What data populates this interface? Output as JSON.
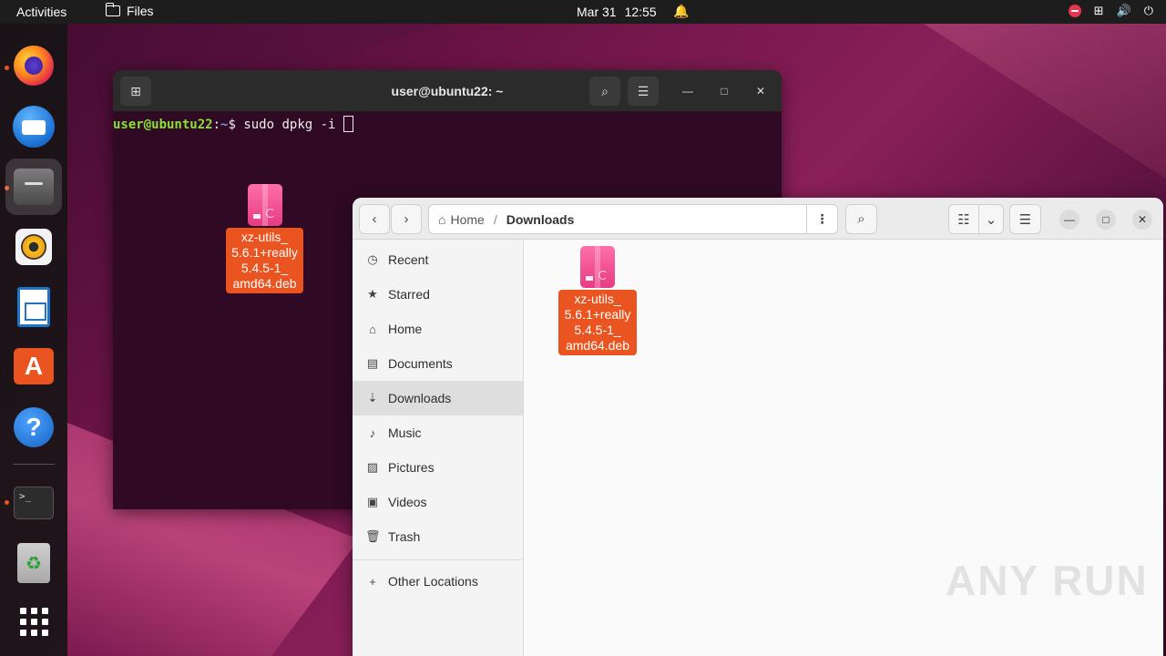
{
  "topbar": {
    "activities": "Activities",
    "app_name": "Files",
    "date": "Mar 31",
    "time": "12:55"
  },
  "dock": {
    "items": [
      "firefox-icon",
      "thunderbird-icon",
      "files-icon",
      "rhythmbox-icon",
      "libreoffice-writer-icon",
      "app-center-icon",
      "help-icon",
      "terminal-icon",
      "trash-icon",
      "show-apps-icon"
    ]
  },
  "terminal": {
    "title": "user@ubuntu22: ~",
    "prompt_user": "user@ubuntu22",
    "prompt_sep": ":",
    "prompt_dir": "~",
    "prompt_sym": "$ ",
    "command": "sudo dpkg -i "
  },
  "desktop_file": {
    "name": "xz-utils_ 5.6.1+really 5.4.5-1_ amd64.deb",
    "line1": "xz-utils_",
    "line2": "5.6.1+really",
    "line3": "5.4.5-1_",
    "line4": "amd64.deb"
  },
  "files_window": {
    "path_home": "Home",
    "path_sep": "/",
    "path_current": "Downloads",
    "sidebar": [
      {
        "label": "Recent",
        "icon": "clock-icon"
      },
      {
        "label": "Starred",
        "icon": "star-icon"
      },
      {
        "label": "Home",
        "icon": "home-icon"
      },
      {
        "label": "Documents",
        "icon": "document-icon"
      },
      {
        "label": "Downloads",
        "icon": "download-icon"
      },
      {
        "label": "Music",
        "icon": "music-icon"
      },
      {
        "label": "Pictures",
        "icon": "picture-icon"
      },
      {
        "label": "Videos",
        "icon": "video-icon"
      },
      {
        "label": "Trash",
        "icon": "trash-icon"
      }
    ],
    "other_locations": "Other Locations",
    "selected": "Downloads",
    "file": {
      "line1": "xz-utils_",
      "line2": "5.6.1+really",
      "line3": "5.4.5-1_",
      "line4": "amd64.deb"
    }
  },
  "watermark": "ANY RUN",
  "colors": {
    "accent": "#e95420",
    "terminal_bg": "#300a24",
    "prompt_user": "#8ae234",
    "prompt_dir": "#729fcf"
  }
}
